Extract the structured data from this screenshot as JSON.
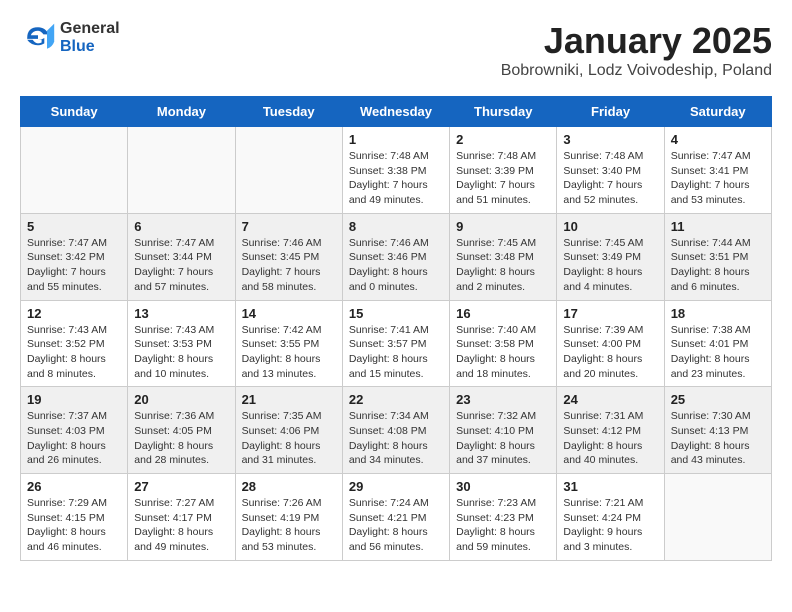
{
  "logo": {
    "general": "General",
    "blue": "Blue"
  },
  "title": "January 2025",
  "subtitle": "Bobrowniki, Lodz Voivodeship, Poland",
  "weekdays": [
    "Sunday",
    "Monday",
    "Tuesday",
    "Wednesday",
    "Thursday",
    "Friday",
    "Saturday"
  ],
  "weeks": [
    [
      {
        "day": "",
        "info": ""
      },
      {
        "day": "",
        "info": ""
      },
      {
        "day": "",
        "info": ""
      },
      {
        "day": "1",
        "info": "Sunrise: 7:48 AM\nSunset: 3:38 PM\nDaylight: 7 hours and 49 minutes."
      },
      {
        "day": "2",
        "info": "Sunrise: 7:48 AM\nSunset: 3:39 PM\nDaylight: 7 hours and 51 minutes."
      },
      {
        "day": "3",
        "info": "Sunrise: 7:48 AM\nSunset: 3:40 PM\nDaylight: 7 hours and 52 minutes."
      },
      {
        "day": "4",
        "info": "Sunrise: 7:47 AM\nSunset: 3:41 PM\nDaylight: 7 hours and 53 minutes."
      }
    ],
    [
      {
        "day": "5",
        "info": "Sunrise: 7:47 AM\nSunset: 3:42 PM\nDaylight: 7 hours and 55 minutes."
      },
      {
        "day": "6",
        "info": "Sunrise: 7:47 AM\nSunset: 3:44 PM\nDaylight: 7 hours and 57 minutes."
      },
      {
        "day": "7",
        "info": "Sunrise: 7:46 AM\nSunset: 3:45 PM\nDaylight: 7 hours and 58 minutes."
      },
      {
        "day": "8",
        "info": "Sunrise: 7:46 AM\nSunset: 3:46 PM\nDaylight: 8 hours and 0 minutes."
      },
      {
        "day": "9",
        "info": "Sunrise: 7:45 AM\nSunset: 3:48 PM\nDaylight: 8 hours and 2 minutes."
      },
      {
        "day": "10",
        "info": "Sunrise: 7:45 AM\nSunset: 3:49 PM\nDaylight: 8 hours and 4 minutes."
      },
      {
        "day": "11",
        "info": "Sunrise: 7:44 AM\nSunset: 3:51 PM\nDaylight: 8 hours and 6 minutes."
      }
    ],
    [
      {
        "day": "12",
        "info": "Sunrise: 7:43 AM\nSunset: 3:52 PM\nDaylight: 8 hours and 8 minutes."
      },
      {
        "day": "13",
        "info": "Sunrise: 7:43 AM\nSunset: 3:53 PM\nDaylight: 8 hours and 10 minutes."
      },
      {
        "day": "14",
        "info": "Sunrise: 7:42 AM\nSunset: 3:55 PM\nDaylight: 8 hours and 13 minutes."
      },
      {
        "day": "15",
        "info": "Sunrise: 7:41 AM\nSunset: 3:57 PM\nDaylight: 8 hours and 15 minutes."
      },
      {
        "day": "16",
        "info": "Sunrise: 7:40 AM\nSunset: 3:58 PM\nDaylight: 8 hours and 18 minutes."
      },
      {
        "day": "17",
        "info": "Sunrise: 7:39 AM\nSunset: 4:00 PM\nDaylight: 8 hours and 20 minutes."
      },
      {
        "day": "18",
        "info": "Sunrise: 7:38 AM\nSunset: 4:01 PM\nDaylight: 8 hours and 23 minutes."
      }
    ],
    [
      {
        "day": "19",
        "info": "Sunrise: 7:37 AM\nSunset: 4:03 PM\nDaylight: 8 hours and 26 minutes."
      },
      {
        "day": "20",
        "info": "Sunrise: 7:36 AM\nSunset: 4:05 PM\nDaylight: 8 hours and 28 minutes."
      },
      {
        "day": "21",
        "info": "Sunrise: 7:35 AM\nSunset: 4:06 PM\nDaylight: 8 hours and 31 minutes."
      },
      {
        "day": "22",
        "info": "Sunrise: 7:34 AM\nSunset: 4:08 PM\nDaylight: 8 hours and 34 minutes."
      },
      {
        "day": "23",
        "info": "Sunrise: 7:32 AM\nSunset: 4:10 PM\nDaylight: 8 hours and 37 minutes."
      },
      {
        "day": "24",
        "info": "Sunrise: 7:31 AM\nSunset: 4:12 PM\nDaylight: 8 hours and 40 minutes."
      },
      {
        "day": "25",
        "info": "Sunrise: 7:30 AM\nSunset: 4:13 PM\nDaylight: 8 hours and 43 minutes."
      }
    ],
    [
      {
        "day": "26",
        "info": "Sunrise: 7:29 AM\nSunset: 4:15 PM\nDaylight: 8 hours and 46 minutes."
      },
      {
        "day": "27",
        "info": "Sunrise: 7:27 AM\nSunset: 4:17 PM\nDaylight: 8 hours and 49 minutes."
      },
      {
        "day": "28",
        "info": "Sunrise: 7:26 AM\nSunset: 4:19 PM\nDaylight: 8 hours and 53 minutes."
      },
      {
        "day": "29",
        "info": "Sunrise: 7:24 AM\nSunset: 4:21 PM\nDaylight: 8 hours and 56 minutes."
      },
      {
        "day": "30",
        "info": "Sunrise: 7:23 AM\nSunset: 4:23 PM\nDaylight: 8 hours and 59 minutes."
      },
      {
        "day": "31",
        "info": "Sunrise: 7:21 AM\nSunset: 4:24 PM\nDaylight: 9 hours and 3 minutes."
      },
      {
        "day": "",
        "info": ""
      }
    ]
  ]
}
